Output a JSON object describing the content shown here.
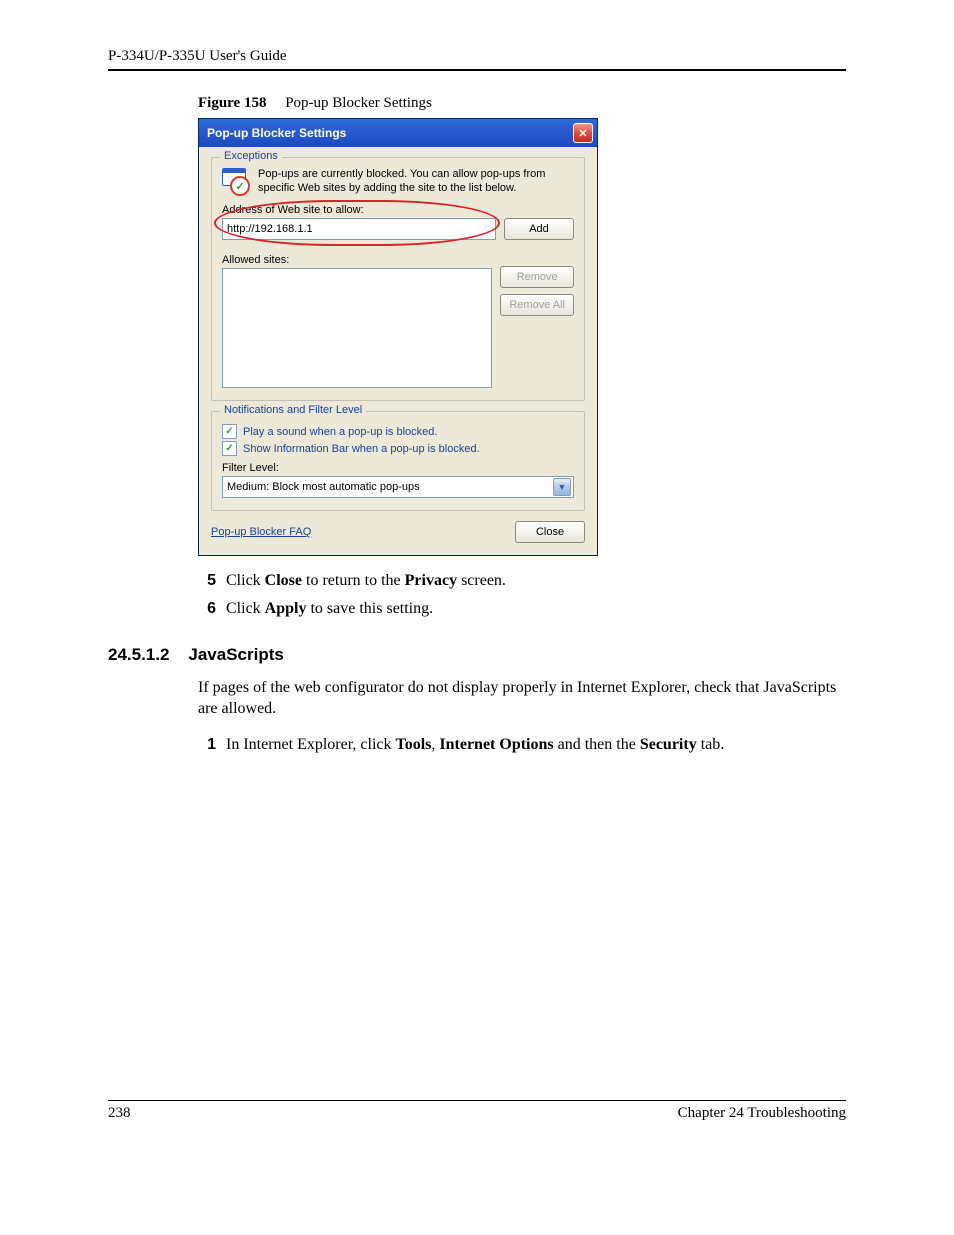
{
  "header": {
    "running_head": "P-334U/P-335U User's Guide"
  },
  "figure": {
    "label": "Figure 158",
    "caption": "Pop-up Blocker Settings"
  },
  "dialog": {
    "title": "Pop-up Blocker Settings",
    "exceptions": {
      "legend": "Exceptions",
      "info": "Pop-ups are currently blocked. You can allow pop-ups from specific Web sites by adding the site to the list below.",
      "address_label": "Address of Web site to allow:",
      "address_value": "http://192.168.1.1",
      "add": "Add",
      "allowed_label": "Allowed sites:",
      "remove": "Remove",
      "remove_all": "Remove All"
    },
    "notifications": {
      "legend": "Notifications and Filter Level",
      "play_sound": "Play a sound when a pop-up is blocked.",
      "show_bar": "Show Information Bar when a pop-up is blocked.",
      "filter_label": "Filter Level:",
      "filter_value": "Medium: Block most automatic pop-ups"
    },
    "faq": "Pop-up Blocker FAQ",
    "close": "Close"
  },
  "steps_a": {
    "s5": {
      "num": "5",
      "pre": "Click ",
      "b1": "Close",
      "mid": " to return to the ",
      "b2": "Privacy",
      "post": " screen."
    },
    "s6": {
      "num": "6",
      "pre": "Click ",
      "b1": "Apply",
      "post": " to save this setting."
    }
  },
  "section": {
    "num": "24.5.1.2",
    "title": "JavaScripts",
    "para": "If pages of the web configurator do not display properly in Internet Explorer, check that JavaScripts are allowed."
  },
  "steps_b": {
    "s1": {
      "num": "1",
      "pre": "In Internet Explorer, click ",
      "b1": "Tools",
      "c1": ", ",
      "b2": "Internet Options",
      "mid": " and then the ",
      "b3": "Security",
      "post": " tab."
    }
  },
  "footer": {
    "page": "238",
    "chapter": "Chapter 24 Troubleshooting"
  }
}
